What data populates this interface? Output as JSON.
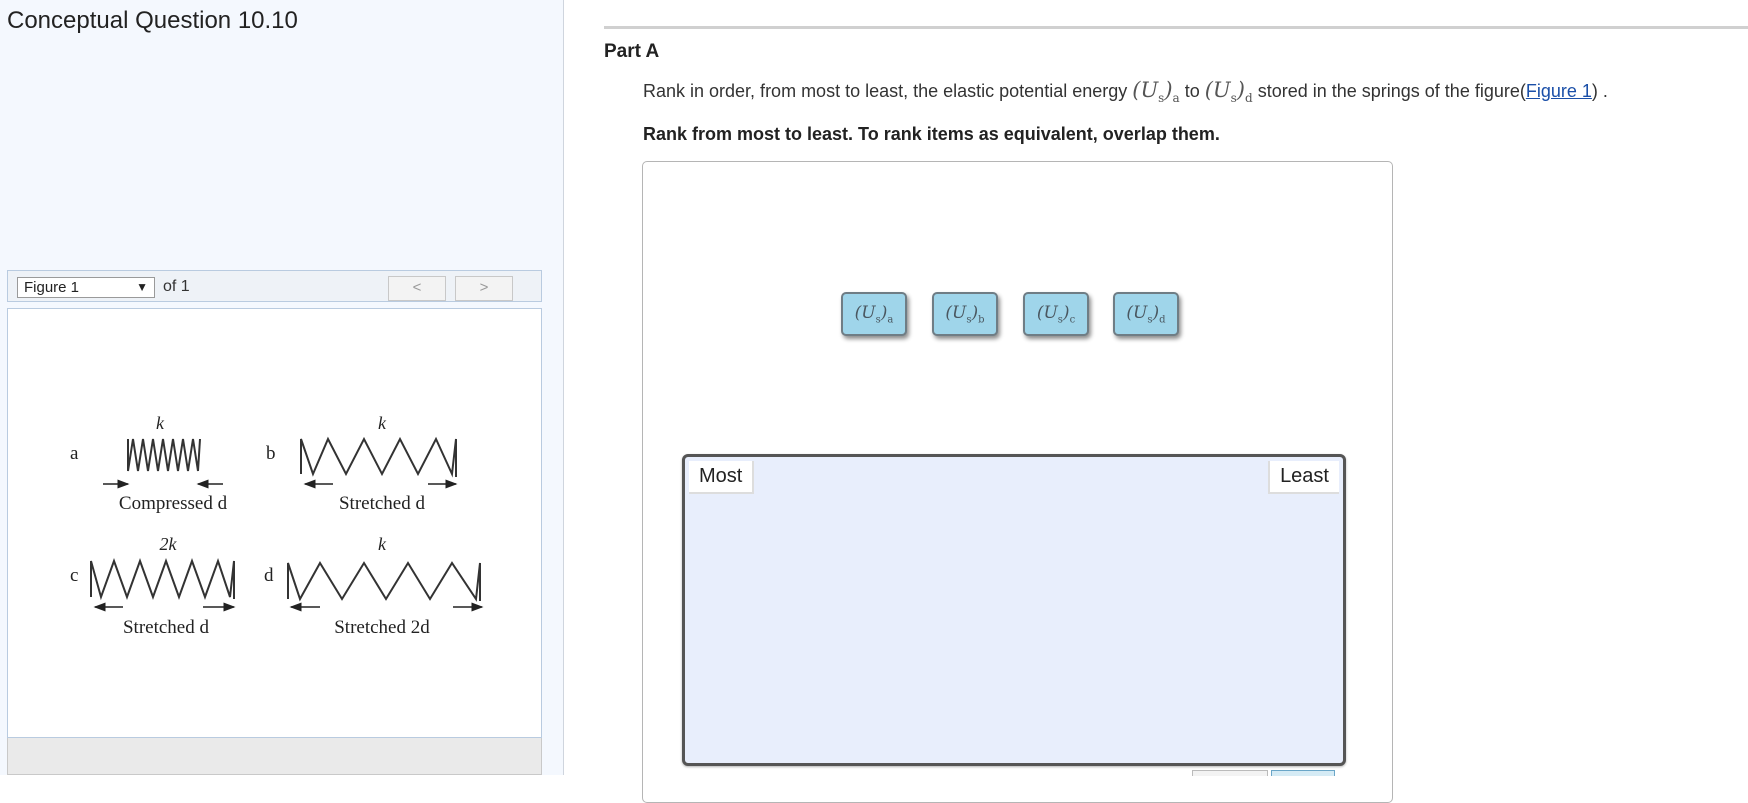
{
  "page": {
    "title": "Conceptual Question 10.10"
  },
  "figure_panel": {
    "select_value": "Figure 1",
    "of_text": "of 1",
    "prev_label": "<",
    "next_label": ">",
    "figure": {
      "panels": [
        {
          "letter": "a",
          "k_label": "k",
          "caption": "Compressed d"
        },
        {
          "letter": "b",
          "k_label": "k",
          "caption": "Stretched d"
        },
        {
          "letter": "c",
          "k_label": "2k",
          "caption": "Stretched d"
        },
        {
          "letter": "d",
          "k_label": "k",
          "caption": "Stretched 2d"
        }
      ]
    }
  },
  "part": {
    "title": "Part A",
    "question_prefix": "Rank in order, from most to least, the elastic potential energy ",
    "math_from_base": "(U",
    "math_from_sub_s": "s",
    "math_from_close": ")",
    "math_from_sub": "a",
    "question_mid": " to ",
    "math_to_base": "(U",
    "math_to_sub_s": "s",
    "math_to_close": ")",
    "math_to_sub": "d",
    "question_suffix": " stored in the springs of the figure(",
    "figure_link": "Figure 1",
    "question_end": ") .",
    "instruction": "Rank from most to least. To rank items as equivalent, overlap them."
  },
  "ranking": {
    "items": [
      {
        "base": "(U",
        "sub_s": "s",
        "close": ")",
        "sub": "a"
      },
      {
        "base": "(U",
        "sub_s": "s",
        "close": ")",
        "sub": "b"
      },
      {
        "base": "(U",
        "sub_s": "s",
        "close": ")",
        "sub": "c"
      },
      {
        "base": "(U",
        "sub_s": "s",
        "close": ")",
        "sub": "d"
      }
    ],
    "most_label": "Most",
    "least_label": "Least"
  }
}
